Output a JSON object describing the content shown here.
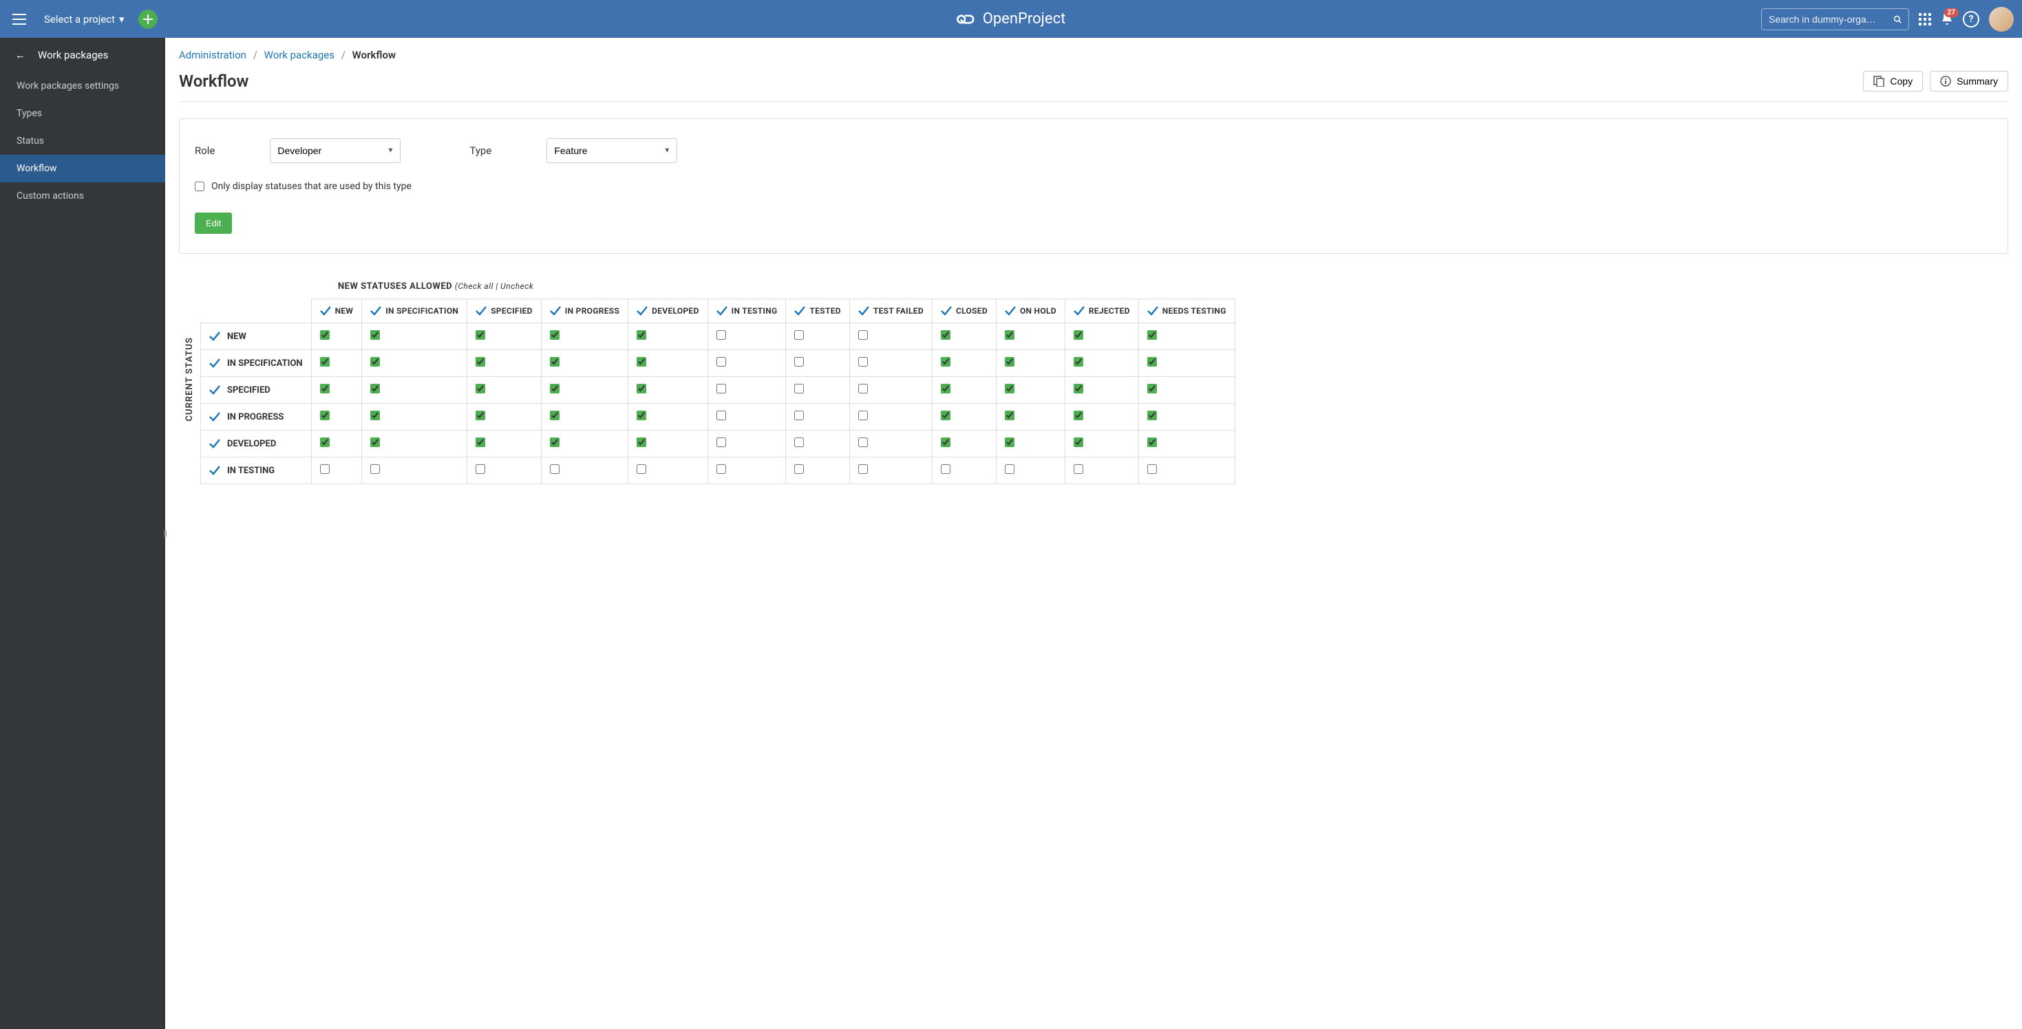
{
  "topbar": {
    "project_selector": "Select a project",
    "brand": "OpenProject",
    "search_placeholder": "Search in dummy-orga…",
    "notification_count": "27"
  },
  "sidebar": {
    "back_label": "Work packages",
    "items": [
      {
        "label": "Work packages settings",
        "active": false
      },
      {
        "label": "Types",
        "active": false
      },
      {
        "label": "Status",
        "active": false
      },
      {
        "label": "Workflow",
        "active": true
      },
      {
        "label": "Custom actions",
        "active": false
      }
    ]
  },
  "breadcrumb": {
    "seg1": "Administration",
    "seg2": "Work packages",
    "current": "Workflow"
  },
  "header": {
    "title": "Workflow",
    "copy_label": "Copy",
    "summary_label": "Summary"
  },
  "form": {
    "role_label": "Role",
    "role_value": "Developer",
    "type_label": "Type",
    "type_value": "Feature",
    "only_used_label": "Only display statuses that are used by this type",
    "only_used_checked": false,
    "edit_label": "Edit"
  },
  "matrix": {
    "vertical_label": "CURRENT STATUS",
    "caption_prefix": "NEW STATUSES ALLOWED",
    "caption_links": "(Check all | Uncheck",
    "columns": [
      "NEW",
      "IN SPECIFICATION",
      "SPECIFIED",
      "IN PROGRESS",
      "DEVELOPED",
      "IN TESTING",
      "TESTED",
      "TEST FAILED",
      "CLOSED",
      "ON HOLD",
      "REJECTED",
      "NEEDS TESTING"
    ],
    "rows": [
      {
        "label": "NEW",
        "cells": [
          true,
          true,
          true,
          true,
          true,
          false,
          false,
          false,
          true,
          true,
          true,
          true
        ]
      },
      {
        "label": "IN SPECIFICATION",
        "cells": [
          true,
          true,
          true,
          true,
          true,
          false,
          false,
          false,
          true,
          true,
          true,
          true
        ]
      },
      {
        "label": "SPECIFIED",
        "cells": [
          true,
          true,
          true,
          true,
          true,
          false,
          false,
          false,
          true,
          true,
          true,
          true
        ]
      },
      {
        "label": "IN PROGRESS",
        "cells": [
          true,
          true,
          true,
          true,
          true,
          false,
          false,
          false,
          true,
          true,
          true,
          true
        ]
      },
      {
        "label": "DEVELOPED",
        "cells": [
          true,
          true,
          true,
          true,
          true,
          false,
          false,
          false,
          true,
          true,
          true,
          true
        ]
      },
      {
        "label": "IN TESTING",
        "cells": [
          false,
          false,
          false,
          false,
          false,
          false,
          false,
          false,
          false,
          false,
          false,
          false
        ]
      }
    ]
  }
}
